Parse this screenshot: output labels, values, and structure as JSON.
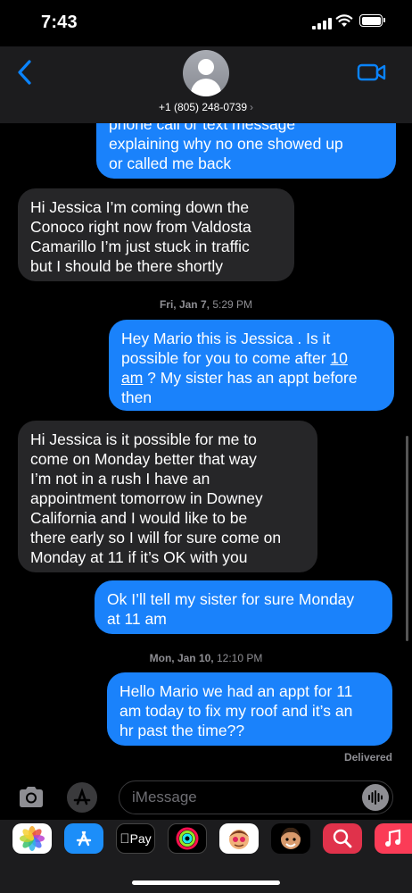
{
  "status": {
    "time": "7:43"
  },
  "header": {
    "contact": "+1 (805) 248-0739",
    "chevron": "›"
  },
  "messages": [
    {
      "dir": "sent",
      "text": "phone call or text message\nexplaining why no one showed up\nor called me back"
    },
    {
      "dir": "recv",
      "text": "Hi Jessica I’m coming down the\nConoco right now from Valdosta\nCamarillo I’m just stuck in traffic\nbut I should be there shortly"
    },
    {
      "dir": "ts",
      "day": "Fri, Jan 7,",
      "time": "5:29 PM"
    },
    {
      "dir": "sent",
      "text_a": "Hey Mario this is Jessica . Is it\npossible for you to come after ",
      "text_link": "10\nam",
      "text_b": " ? My sister has an appt before\nthen"
    },
    {
      "dir": "recv",
      "text": "Hi Jessica is it possible for me to\ncome on Monday better that way\nI’m not in a rush I have an\nappointment tomorrow in Downey\nCalifornia and I would like to be\nthere early so I will for sure come on\nMonday at 11 if it’s OK with you"
    },
    {
      "dir": "sent",
      "text": "Ok I’ll tell my sister for sure Monday\nat 11 am"
    },
    {
      "dir": "ts",
      "day": "Mon, Jan 10,",
      "time": "12:10 PM"
    },
    {
      "dir": "sent",
      "text": "Hello Mario we had an appt for 11\nam today to fix my roof and it’s an\nhr past the time??"
    }
  ],
  "delivered": "Delivered",
  "composer": {
    "placeholder": "iMessage"
  },
  "tray": [
    {
      "name": "photos-app-icon",
      "label": ""
    },
    {
      "name": "app-store-icon",
      "label": ""
    },
    {
      "name": "apple-pay-icon",
      "label": "Pay"
    },
    {
      "name": "activity-icon",
      "label": ""
    },
    {
      "name": "memoji-icon",
      "label": ""
    },
    {
      "name": "memoji-2-icon",
      "label": ""
    },
    {
      "name": "search-images-icon",
      "label": ""
    },
    {
      "name": "music-icon",
      "label": ""
    }
  ],
  "colors": {
    "sent_bubble": "#1a82fb",
    "recv_bubble": "#262628",
    "accent": "#0a84ff"
  }
}
